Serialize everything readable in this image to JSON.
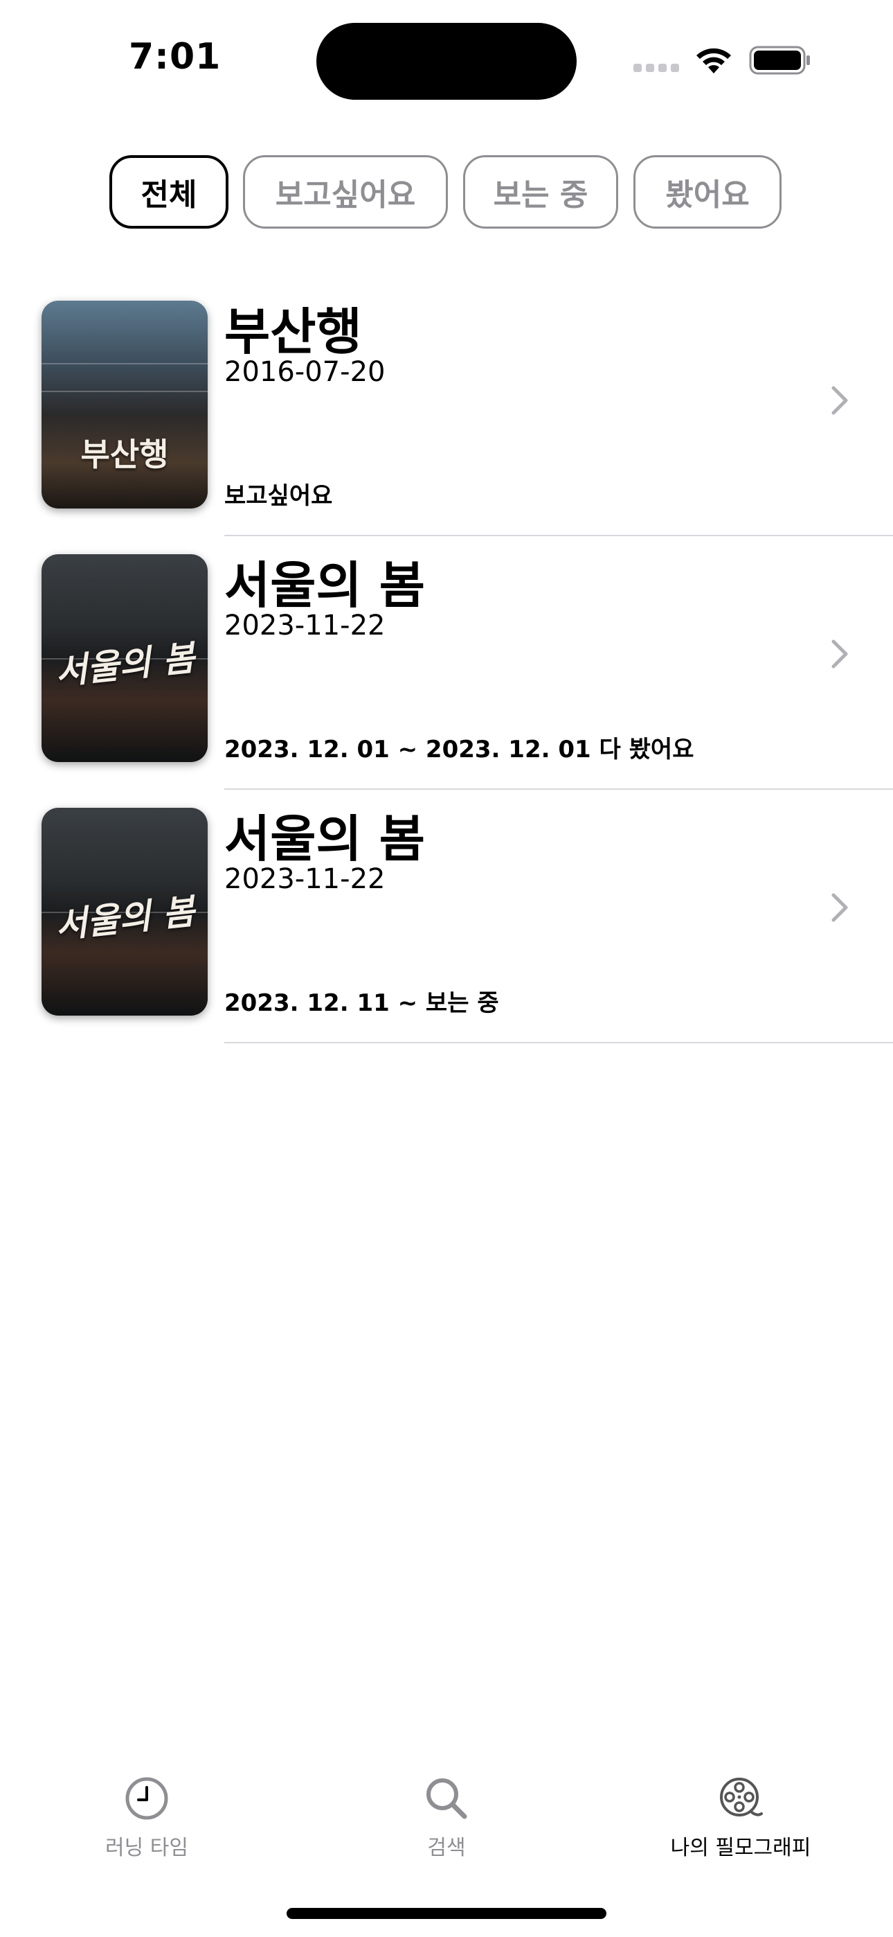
{
  "status_bar": {
    "time": "7:01"
  },
  "filters": {
    "selected": "전체",
    "items": [
      {
        "label": "전체",
        "active": true
      },
      {
        "label": "보고싶어요",
        "active": false
      },
      {
        "label": "보는 중",
        "active": false
      },
      {
        "label": "봤어요",
        "active": false
      }
    ]
  },
  "movies": [
    {
      "title": "부산행",
      "release_date": "2016-07-20",
      "status": "보고싶어요",
      "poster_text": "부산행"
    },
    {
      "title": "서울의 봄",
      "release_date": "2023-11-22",
      "status": "2023. 12. 01 ~ 2023. 12. 01 다 봤어요",
      "poster_text": "서울의 봄"
    },
    {
      "title": "서울의 봄",
      "release_date": "2023-11-22",
      "status": "2023. 12. 11 ~ 보는 중",
      "poster_text": "서울의 봄"
    }
  ],
  "tab_bar": {
    "items": [
      {
        "label": "러닝 타임",
        "icon": "clock-icon",
        "active": false
      },
      {
        "label": "검색",
        "icon": "search-icon",
        "active": false
      },
      {
        "label": "나의 필모그래피",
        "icon": "film-reel-icon",
        "active": true
      }
    ]
  },
  "colors": {
    "inactive_gray": "#8e8e93",
    "active_black": "#000000",
    "divider": "#d8d8dc"
  }
}
